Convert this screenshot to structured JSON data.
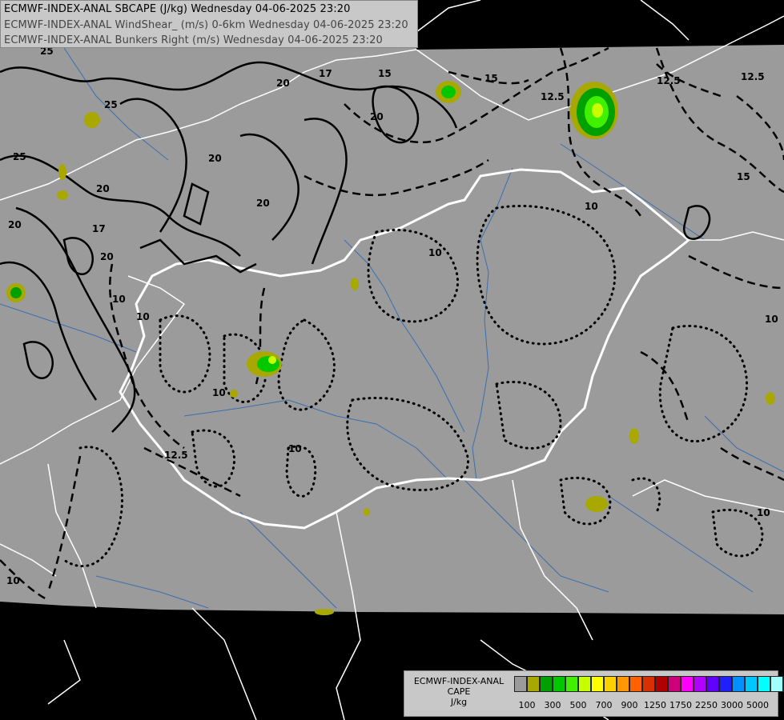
{
  "titles": {
    "line1": "ECMWF-INDEX-ANAL SBCAPE (J/kg) Wednesday 04-06-2025 23:20",
    "line2": "ECMWF-INDEX-ANAL WindShear_ (m/s) 0-6km Wednesday 04-06-2025 23:20",
    "line3": "ECMWF-INDEX-ANAL Bunkers Right (m/s) Wednesday 04-06-2025 23:20"
  },
  "legend": {
    "title1": "ECMWF-INDEX-ANAL",
    "title2": "CAPE",
    "unit": "J/kg",
    "colors": [
      "#9b9b9b",
      "#a8a800",
      "#00a000",
      "#00c800",
      "#40f000",
      "#c8ff00",
      "#ffff00",
      "#ffd000",
      "#ff9800",
      "#ff6000",
      "#d83000",
      "#b00000",
      "#d0007a",
      "#ff00ff",
      "#b000ff",
      "#6000ff",
      "#2020ff",
      "#0090ff",
      "#00c8ff",
      "#00ffff",
      "#a0ffff",
      "#ffffff"
    ],
    "ticks": [
      "100",
      "300",
      "500",
      "700",
      "900",
      "1250",
      "1750",
      "2250",
      "3000",
      "5000"
    ]
  },
  "contour_labels": [
    "25",
    "20",
    "17",
    "15",
    "12.5",
    "12.5",
    "12.5",
    "15",
    "20",
    "25",
    "20",
    "20",
    "17",
    "20",
    "20",
    "15",
    "10",
    "10",
    "10",
    "12.5",
    "10",
    "10",
    "10",
    "10",
    "10",
    "10",
    "20",
    "25"
  ],
  "colors": {
    "background_outside": "#000000",
    "domain": "#9b9b9b",
    "country_border": "#ffffff",
    "rivers": "#3a6fb0"
  }
}
